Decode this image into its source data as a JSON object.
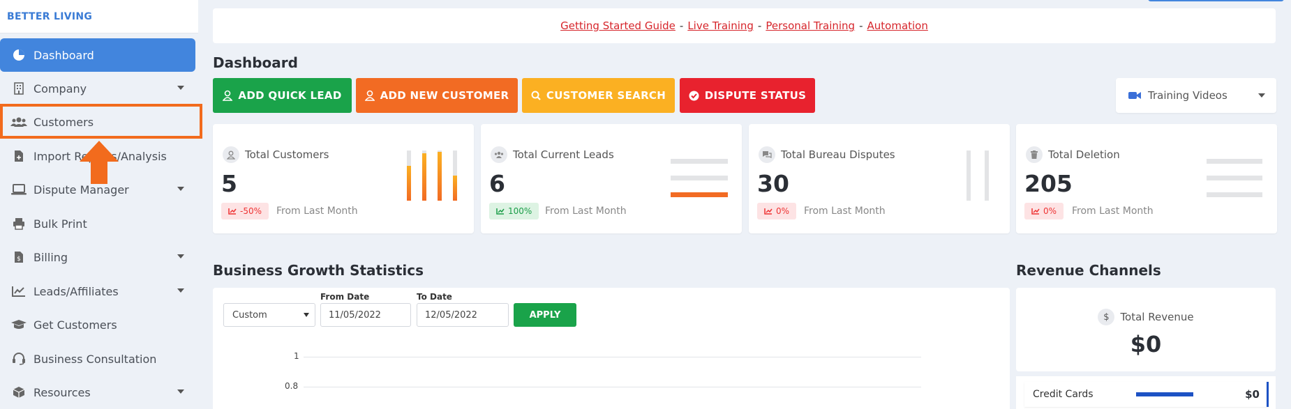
{
  "brand": "BETTER LIVING",
  "sidebar": {
    "items": [
      {
        "label": "Dashboard",
        "icon": "pie-chart-icon",
        "active": true,
        "caret": false
      },
      {
        "label": "Company",
        "icon": "building-icon",
        "caret": true
      },
      {
        "label": "Customers",
        "icon": "users-icon",
        "caret": false,
        "highlighted": true
      },
      {
        "label": "Import Reports/Analysis",
        "icon": "file-import-icon",
        "caret": false
      },
      {
        "label": "Dispute Manager",
        "icon": "laptop-icon",
        "caret": true
      },
      {
        "label": "Bulk Print",
        "icon": "printer-icon",
        "caret": false
      },
      {
        "label": "Billing",
        "icon": "invoice-icon",
        "caret": true
      },
      {
        "label": "Leads/Affiliates",
        "icon": "line-chart-icon",
        "caret": true
      },
      {
        "label": "Get Customers",
        "icon": "graduation-cap-icon",
        "caret": false
      },
      {
        "label": "Business Consultation",
        "icon": "headset-icon",
        "caret": false
      },
      {
        "label": "Resources",
        "icon": "box-icon",
        "caret": true
      }
    ]
  },
  "links": {
    "items": [
      "Getting Started Guide",
      "Live Training",
      "Personal Training",
      "Automation"
    ],
    "separator": "-"
  },
  "dashboard": {
    "title": "Dashboard",
    "actions": {
      "add_quick_lead": "ADD QUICK LEAD",
      "add_new_customer": "ADD NEW CUSTOMER",
      "customer_search": "CUSTOMER SEARCH",
      "dispute_status": "DISPUTE STATUS"
    },
    "training_videos": "Training Videos"
  },
  "stats": [
    {
      "title": "Total Customers",
      "value": "5",
      "change": "-50%",
      "trend": "down",
      "from": "From Last Month"
    },
    {
      "title": "Total Current Leads",
      "value": "6",
      "change": "100%",
      "trend": "up",
      "from": "From Last Month"
    },
    {
      "title": "Total Bureau Disputes",
      "value": "30",
      "change": "0%",
      "trend": "down",
      "from": "From Last Month"
    },
    {
      "title": "Total Deletion",
      "value": "205",
      "change": "0%",
      "trend": "down",
      "from": "From Last Month"
    }
  ],
  "growth": {
    "title": "Business Growth Statistics",
    "range_select": "Custom",
    "from_label": "From Date",
    "from_value": "11/05/2022",
    "to_label": "To Date",
    "to_value": "12/05/2022",
    "apply": "APPLY",
    "y_ticks": [
      "1",
      "0.8"
    ]
  },
  "revenue": {
    "title": "Revenue Channels",
    "total_label": "Total Revenue",
    "total_value": "$0",
    "channel_label": "Credit Cards",
    "channel_value": "$0"
  },
  "colors": {
    "accent_blue": "#4285dd",
    "green": "#1aa34a",
    "orange": "#f26b23",
    "yellow": "#fbb022",
    "red": "#e8222e"
  }
}
